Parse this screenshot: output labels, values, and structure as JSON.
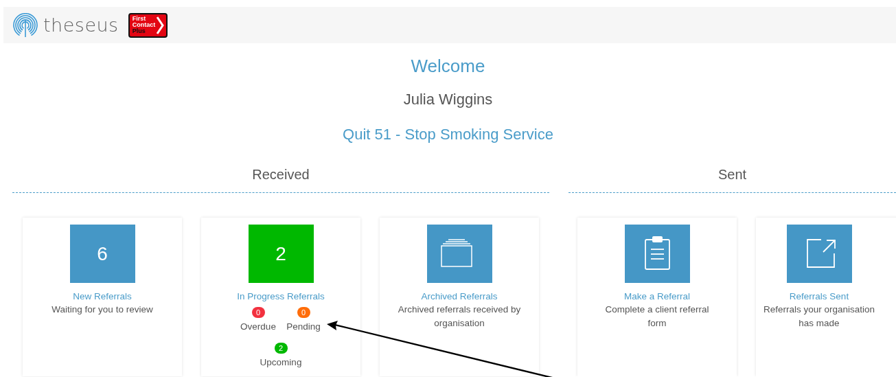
{
  "header": {
    "brand": "theseus",
    "badge_lines": [
      "First",
      "Contact",
      "Plus"
    ]
  },
  "welcome": "Welcome",
  "user_name": "Julia Wiggins",
  "organisation": "Quit 51 - Stop Smoking Service",
  "sections": [
    {
      "title": "Received",
      "cards": [
        {
          "kind": "count",
          "tile_text": "6",
          "color": "#4597c6",
          "title": "New Referrals",
          "description": "Waiting for you to review"
        },
        {
          "kind": "count",
          "tile_text": "2",
          "color": "#00b800",
          "title": "In Progress Referrals",
          "counters": [
            {
              "count": "0",
              "label": "Overdue",
              "color": "#f2313f"
            },
            {
              "count": "0",
              "label": "Pending",
              "color": "#ff6d0a"
            },
            {
              "count": "2",
              "label": "Upcoming",
              "color": "#00b800"
            }
          ]
        },
        {
          "kind": "archive",
          "color": "#4597c6",
          "title": "Archived Referrals",
          "description": "Archived referrals received by organisation"
        }
      ]
    },
    {
      "title": "Sent",
      "cards": [
        {
          "kind": "clipboard",
          "color": "#4597c6",
          "title": "Make a Referral",
          "description": "Complete a client referral form"
        },
        {
          "kind": "export",
          "color": "#4597c6",
          "title": "Referrals Sent",
          "description": "Referrals your organisation has made"
        }
      ]
    }
  ]
}
